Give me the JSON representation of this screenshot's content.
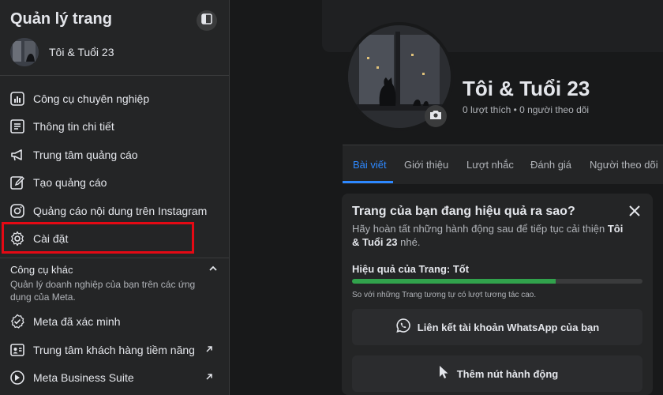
{
  "sidebar": {
    "title": "Quản lý trang",
    "page_name": "Tôi & Tuổi 23",
    "menu": [
      {
        "label": "Công cụ chuyên nghiệp",
        "icon": "professional-tools-icon"
      },
      {
        "label": "Thông tin chi tiết",
        "icon": "insights-icon"
      },
      {
        "label": "Trung tâm quảng cáo",
        "icon": "megaphone-icon"
      },
      {
        "label": "Tạo quảng cáo",
        "icon": "pencil-icon"
      },
      {
        "label": "Quảng cáo nội dung trên Instagram",
        "icon": "instagram-icon"
      },
      {
        "label": "Cài đặt",
        "icon": "gear-icon"
      }
    ],
    "other_tools": {
      "heading": "Công cụ khác",
      "description": "Quản lý doanh nghiệp của bạn trên các ứng dụng của Meta.",
      "items": [
        {
          "label": "Meta đã xác minh",
          "icon": "verified-badge-icon"
        },
        {
          "label": "Trung tâm khách hàng tiềm năng",
          "icon": "contact-card-icon"
        },
        {
          "label": "Meta Business Suite",
          "icon": "meta-business-suite-icon"
        }
      ]
    }
  },
  "profile": {
    "name": "Tôi & Tuổi 23",
    "stats": "0 lượt thích • 0 người theo dõi"
  },
  "tabs": [
    "Bài viết",
    "Giới thiệu",
    "Lượt nhắc",
    "Đánh giá",
    "Người theo dõi"
  ],
  "perf_card": {
    "title": "Trang của bạn đang hiệu quả ra sao?",
    "desc_prefix": "Hãy hoàn tất những hành động sau để tiếp tục cải thiện ",
    "desc_page": "Tôi & Tuổi 23",
    "desc_suffix": " nhé.",
    "perf_label": "Hiệu quả của Trang: Tốt",
    "progress_fraction": 0.7,
    "note": "So với những Trang tương tự có lượt tương tác cao.",
    "actions": [
      {
        "label": "Liên kết tài khoản WhatsApp của bạn",
        "icon": "whatsapp-icon"
      },
      {
        "label": "Thêm nút hành động",
        "icon": "cursor-icon"
      }
    ]
  },
  "colors": {
    "accent_blue": "#2d88ff",
    "progress_green": "#31a24c",
    "highlight_red": "#e50914"
  }
}
